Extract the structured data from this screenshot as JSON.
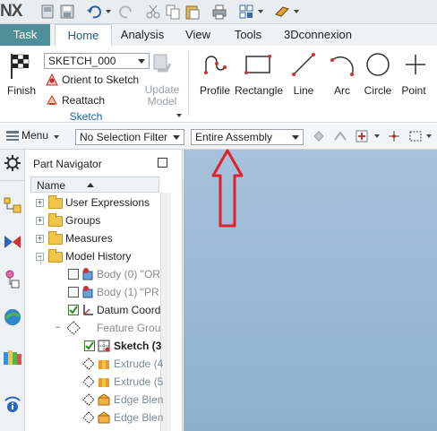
{
  "app": {
    "logo": "NX"
  },
  "tabs": {
    "task": "Task",
    "items": [
      "Home",
      "Analysis",
      "View",
      "Tools",
      "3Dconnexion"
    ]
  },
  "ribbon": {
    "finish": "Finish",
    "sketch_name": "SKETCH_000",
    "orient": "Orient to Sketch",
    "reattach": "Reattach",
    "update_model": "Update Model",
    "group_label": "Sketch",
    "curves": [
      "Profile",
      "Rectangle",
      "Line",
      "Arc",
      "Circle",
      "Point"
    ]
  },
  "selection_bar": {
    "menu": "Menu",
    "filter": "No Selection Filter",
    "scope": "Entire Assembly"
  },
  "navigator": {
    "title": "Part Navigator",
    "column": "Name",
    "rows": [
      {
        "label": "User Expressions"
      },
      {
        "label": "Groups"
      },
      {
        "label": "Measures"
      },
      {
        "label": "Model History"
      },
      {
        "label": "Body (0) \"OR"
      },
      {
        "label": "Body (1) \"PR"
      },
      {
        "label": "Datum Coord"
      },
      {
        "label": "Feature Grou"
      },
      {
        "label": "Sketch (3"
      },
      {
        "label": "Extrude (4"
      },
      {
        "label": "Extrude (5"
      },
      {
        "label": "Edge Blen"
      },
      {
        "label": "Edge Blen"
      }
    ]
  },
  "colors": {
    "task_tab": "#4f8f9a",
    "graphics_bg": "#9bbad6",
    "arrow": "#e0202a"
  }
}
